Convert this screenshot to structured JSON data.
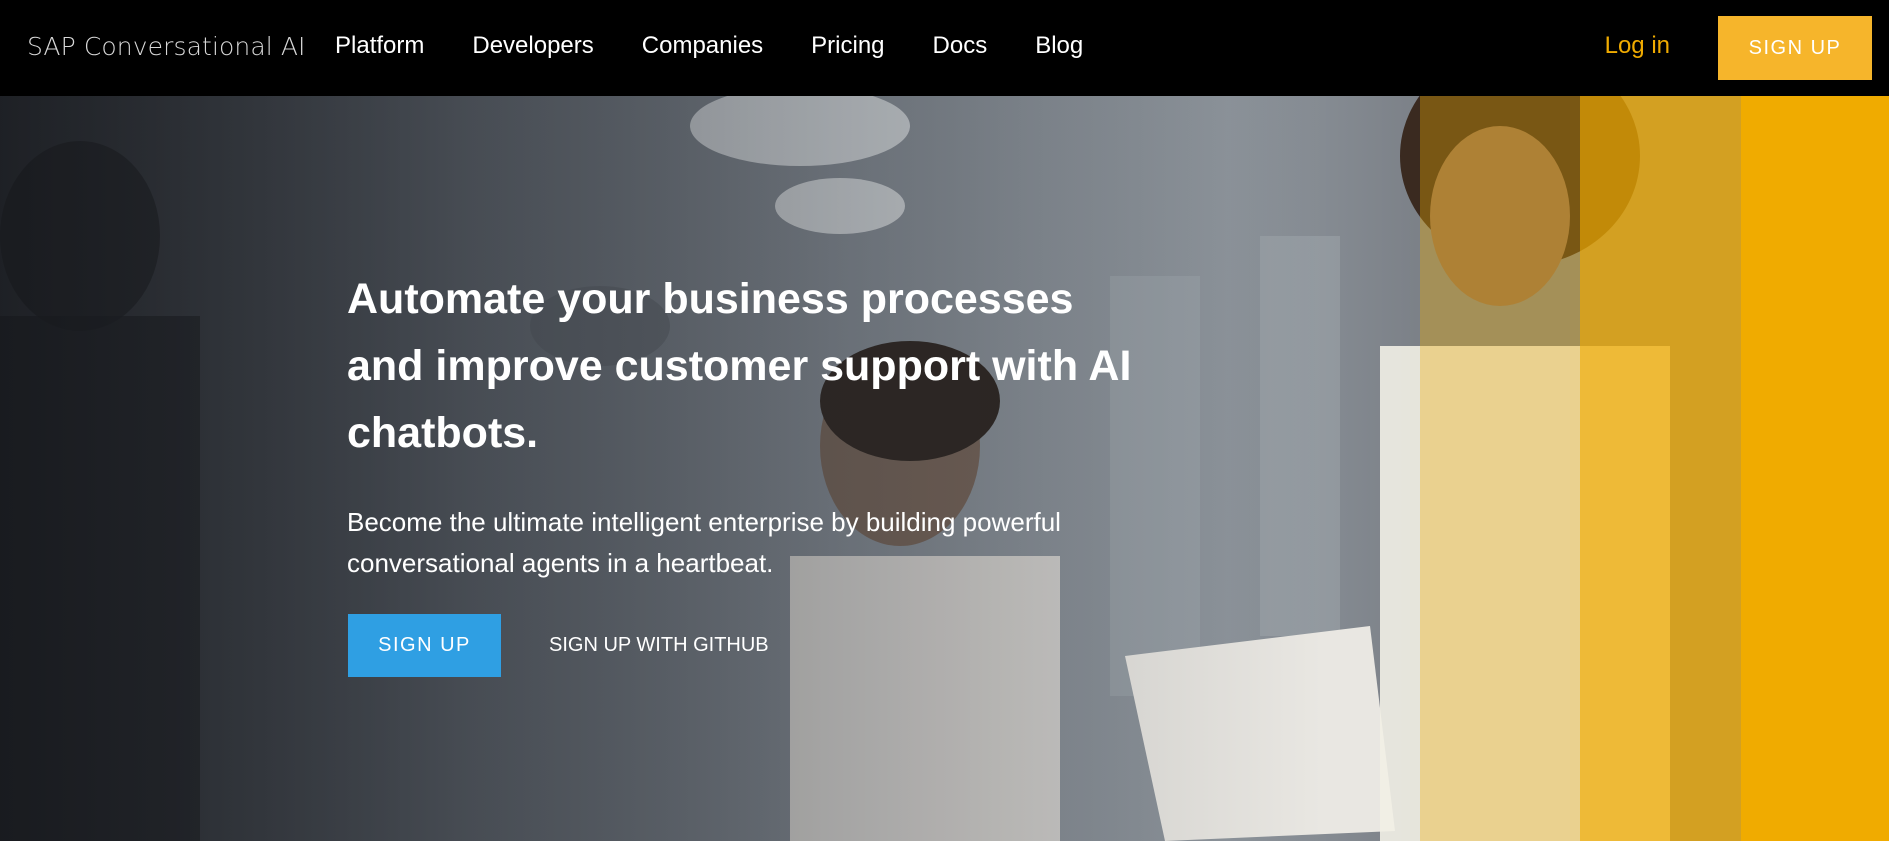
{
  "header": {
    "brand": "SAP Conversational AI",
    "nav_items": [
      "Platform",
      "Developers",
      "Companies",
      "Pricing",
      "Docs",
      "Blog"
    ],
    "login_label": "Log in",
    "signup_label": "SIGN UP"
  },
  "hero": {
    "headline": "Automate your business processes and improve customer support with AI chatbots.",
    "subtext": "Become the ultimate intelligent enterprise by building powerful conversational agents in a heartbeat.",
    "signup_label": "SIGN UP",
    "github_label": "SIGN UP WITH GITHUB",
    "image": "office-team-photo"
  },
  "colors": {
    "nav_bg": "#000000",
    "accent_yellow": "#f0ab00",
    "signup_top_bg": "#f6b52b",
    "signup_hero_bg": "#2f9fe3"
  }
}
